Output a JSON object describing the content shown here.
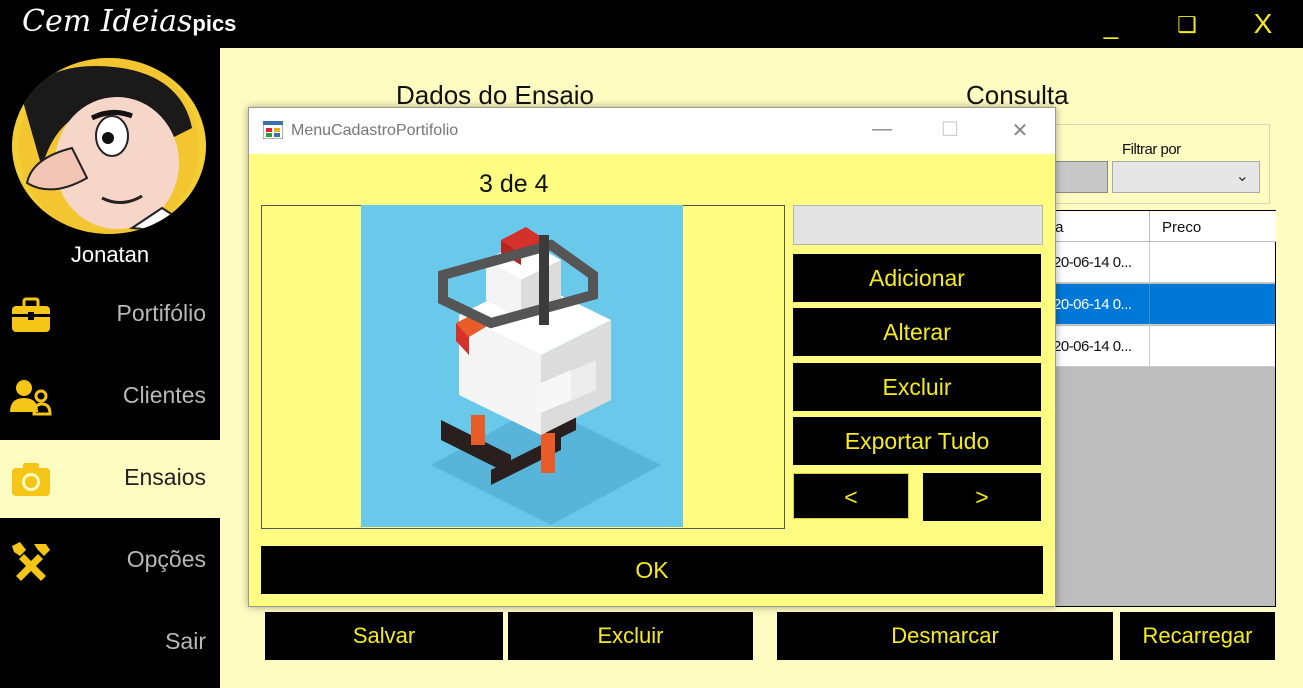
{
  "app": {
    "logo_text": "Cem Ideias",
    "logo_suffix": "pics",
    "window_controls": {
      "minimize": "_",
      "maximize": "❑",
      "close": "X"
    }
  },
  "sidebar": {
    "username": "Jonatan",
    "items": [
      {
        "label": "Portifólio",
        "icon": "briefcase-icon"
      },
      {
        "label": "Clientes",
        "icon": "users-icon"
      },
      {
        "label": "Ensaios",
        "icon": "camera-icon",
        "active": true
      },
      {
        "label": "Opções",
        "icon": "tools-icon"
      },
      {
        "label": "Sair",
        "icon": ""
      }
    ]
  },
  "main": {
    "left_heading": "Dados do Ensaio",
    "right_heading": "Consulta",
    "filter": {
      "label": "Filtrar por",
      "value": ""
    },
    "grid": {
      "columns": [
        "ta",
        "Preco"
      ],
      "rows": [
        {
          "data": "20-06-14 0...",
          "preco": "",
          "selected": false
        },
        {
          "data": "20-06-14 0...",
          "preco": "",
          "selected": true
        },
        {
          "data": "20-06-14 0...",
          "preco": "",
          "selected": false
        }
      ]
    },
    "buttons": {
      "salvar": "Salvar",
      "excluir": "Excluir",
      "desmarcar": "Desmarcar",
      "recarregar": "Recarregar"
    }
  },
  "dialog": {
    "title": "MenuCadastroPortifolio",
    "counter": "3 de 4",
    "input_value": "",
    "buttons": {
      "adicionar": "Adicionar",
      "alterar": "Alterar",
      "excluir": "Excluir",
      "exportar": "Exportar Tudo",
      "prev": "<",
      "next": ">",
      "ok": "OK"
    },
    "controls": {
      "minimize": "—",
      "maximize": "☐",
      "close": "✕"
    }
  },
  "colors": {
    "accent_yellow": "#f5ec1a",
    "main_bg": "#fffcc2",
    "dialog_bg": "#fffc82",
    "selection_blue": "#0078d7"
  }
}
